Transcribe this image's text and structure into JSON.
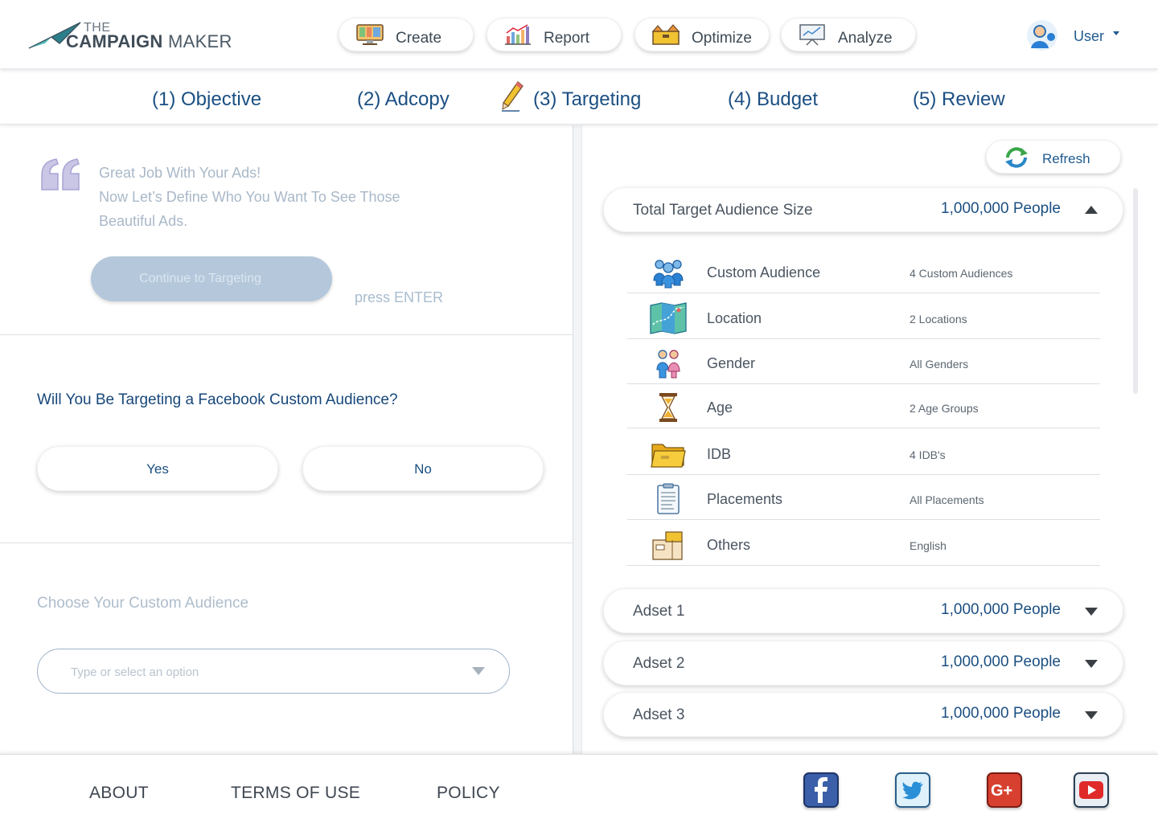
{
  "brand": {
    "logo_top": "THE",
    "logo_bold": "CAMPAIGN",
    "logo_rest": "MAKER"
  },
  "nav": [
    {
      "label": "Create",
      "icon": "monitor-icon"
    },
    {
      "label": "Report",
      "icon": "bar-chart-icon"
    },
    {
      "label": "Optimize",
      "icon": "toolbox-icon"
    },
    {
      "label": "Analyze",
      "icon": "presentation-icon"
    }
  ],
  "user": {
    "name": "User"
  },
  "steps": [
    {
      "label": "(1) Objective"
    },
    {
      "label": "(2) Adcopy"
    },
    {
      "label": "(3) Targeting",
      "active": true
    },
    {
      "label": "(4) Budget"
    },
    {
      "label": "(5) Review"
    }
  ],
  "intro": {
    "line1": "Great Job With Your Ads!",
    "line2": "Now Let’s Define Who You Want To See Those",
    "line3": "Beautiful Ads.",
    "continue_label": "Continue to Targeting",
    "press_enter": "press ENTER"
  },
  "question": {
    "text": "Will You Be Targeting a Facebook Custom Audience?",
    "yes": "Yes",
    "no": "No"
  },
  "custom_audience": {
    "label": "Choose Your Custom Audience",
    "placeholder": "Type or select an option"
  },
  "right": {
    "refresh_label": "Refresh",
    "total": {
      "title": "Total Target Audience Size",
      "value": "1,000,000 People"
    },
    "targeting": [
      {
        "name": "Custom Audience",
        "value": "4 Custom Audiences",
        "icon": "people-group-icon"
      },
      {
        "name": "Location",
        "value": "2 Locations",
        "icon": "map-icon"
      },
      {
        "name": "Gender",
        "value": "All Genders",
        "icon": "gender-icon"
      },
      {
        "name": "Age",
        "value": "2 Age Groups",
        "icon": "hourglass-icon"
      },
      {
        "name": "IDB",
        "value": "4 IDB's",
        "icon": "folder-icon"
      },
      {
        "name": "Placements",
        "value": "All Placements",
        "icon": "clipboard-icon"
      },
      {
        "name": "Others",
        "value": "English",
        "icon": "boxes-icon"
      }
    ],
    "adsets": [
      {
        "title": "Adset 1",
        "value": "1,000,000 People"
      },
      {
        "title": "Adset 2",
        "value": "1,000,000 People"
      },
      {
        "title": "Adset 3",
        "value": "1,000,000 People"
      }
    ]
  },
  "footer": {
    "links": [
      "ABOUT",
      "TERMS OF USE",
      "POLICY"
    ],
    "social": [
      "facebook-icon",
      "twitter-icon",
      "google-plus-icon",
      "youtube-icon"
    ]
  }
}
